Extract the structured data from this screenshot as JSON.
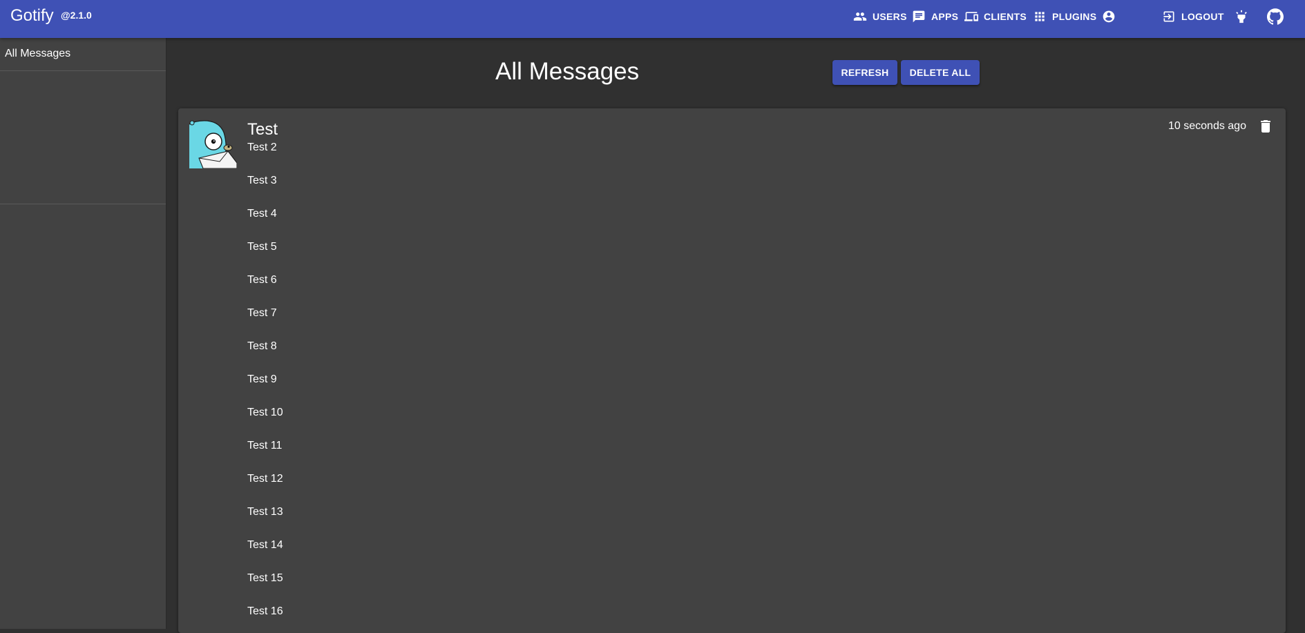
{
  "app": {
    "title": "Gotify",
    "version": "@2.1.0"
  },
  "nav": {
    "users": "USERS",
    "apps": "APPS",
    "clients": "CLIENTS",
    "plugins": "PLUGINS",
    "logout": "LOGOUT"
  },
  "icons": {
    "users": "people-icon",
    "apps": "chat-icon",
    "clients": "devices-icon",
    "plugins": "apps-grid-icon",
    "account": "account-circle-icon",
    "logout": "exit-icon",
    "theme": "highlight-icon",
    "github": "github-icon",
    "delete": "trash-icon"
  },
  "sidebar": {
    "items": [
      {
        "label": "All Messages"
      }
    ]
  },
  "main": {
    "title": "All Messages",
    "refresh_label": "REFRESH",
    "delete_all_label": "DELETE ALL"
  },
  "message": {
    "title": "Test",
    "date": "10 seconds ago",
    "lines": [
      "Test 2",
      "Test 3",
      "Test 4",
      "Test 5",
      "Test 6",
      "Test 7",
      "Test 8",
      "Test 9",
      "Test 10",
      "Test 11",
      "Test 12",
      "Test 13",
      "Test 14",
      "Test 15",
      "Test 16"
    ]
  },
  "colors": {
    "primary": "#3f51b5",
    "background": "#303030",
    "surface": "#424242",
    "gopher_blue": "#6ad7e5"
  }
}
